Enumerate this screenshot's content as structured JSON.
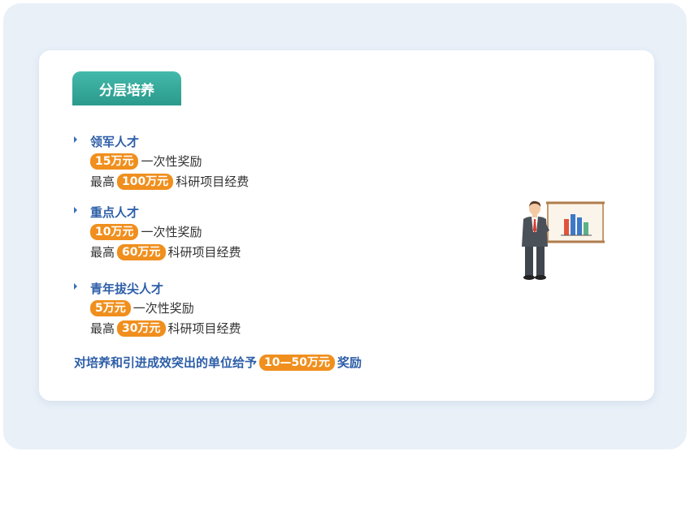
{
  "header": {
    "title": "分层培养"
  },
  "sections": [
    {
      "title": "领军人才",
      "bonus_amount": "15万元",
      "bonus_text": "一次性奖励",
      "funding_prefix": "最高",
      "funding_amount": "100万元",
      "funding_text": "科研项目经费"
    },
    {
      "title": "重点人才",
      "bonus_amount": "10万元",
      "bonus_text": "一次性奖励",
      "funding_prefix": "最高",
      "funding_amount": "60万元",
      "funding_text": "科研项目经费"
    },
    {
      "title": "青年拔尖人才",
      "bonus_amount": "5万元",
      "bonus_text": "一次性奖励",
      "funding_prefix": "最高",
      "funding_amount": "30万元",
      "funding_text": "科研项目经费"
    }
  ],
  "footer": {
    "prefix": "对培养和引进成效突出的单位给予",
    "amount": "10—50万元",
    "suffix": "奖励"
  },
  "colors": {
    "accent_teal": "#2ea596",
    "title_blue": "#2d5ea8",
    "pill_orange": "#f08f1d"
  },
  "illustration": {
    "icon": "presenter-with-bar-chart-icon"
  }
}
